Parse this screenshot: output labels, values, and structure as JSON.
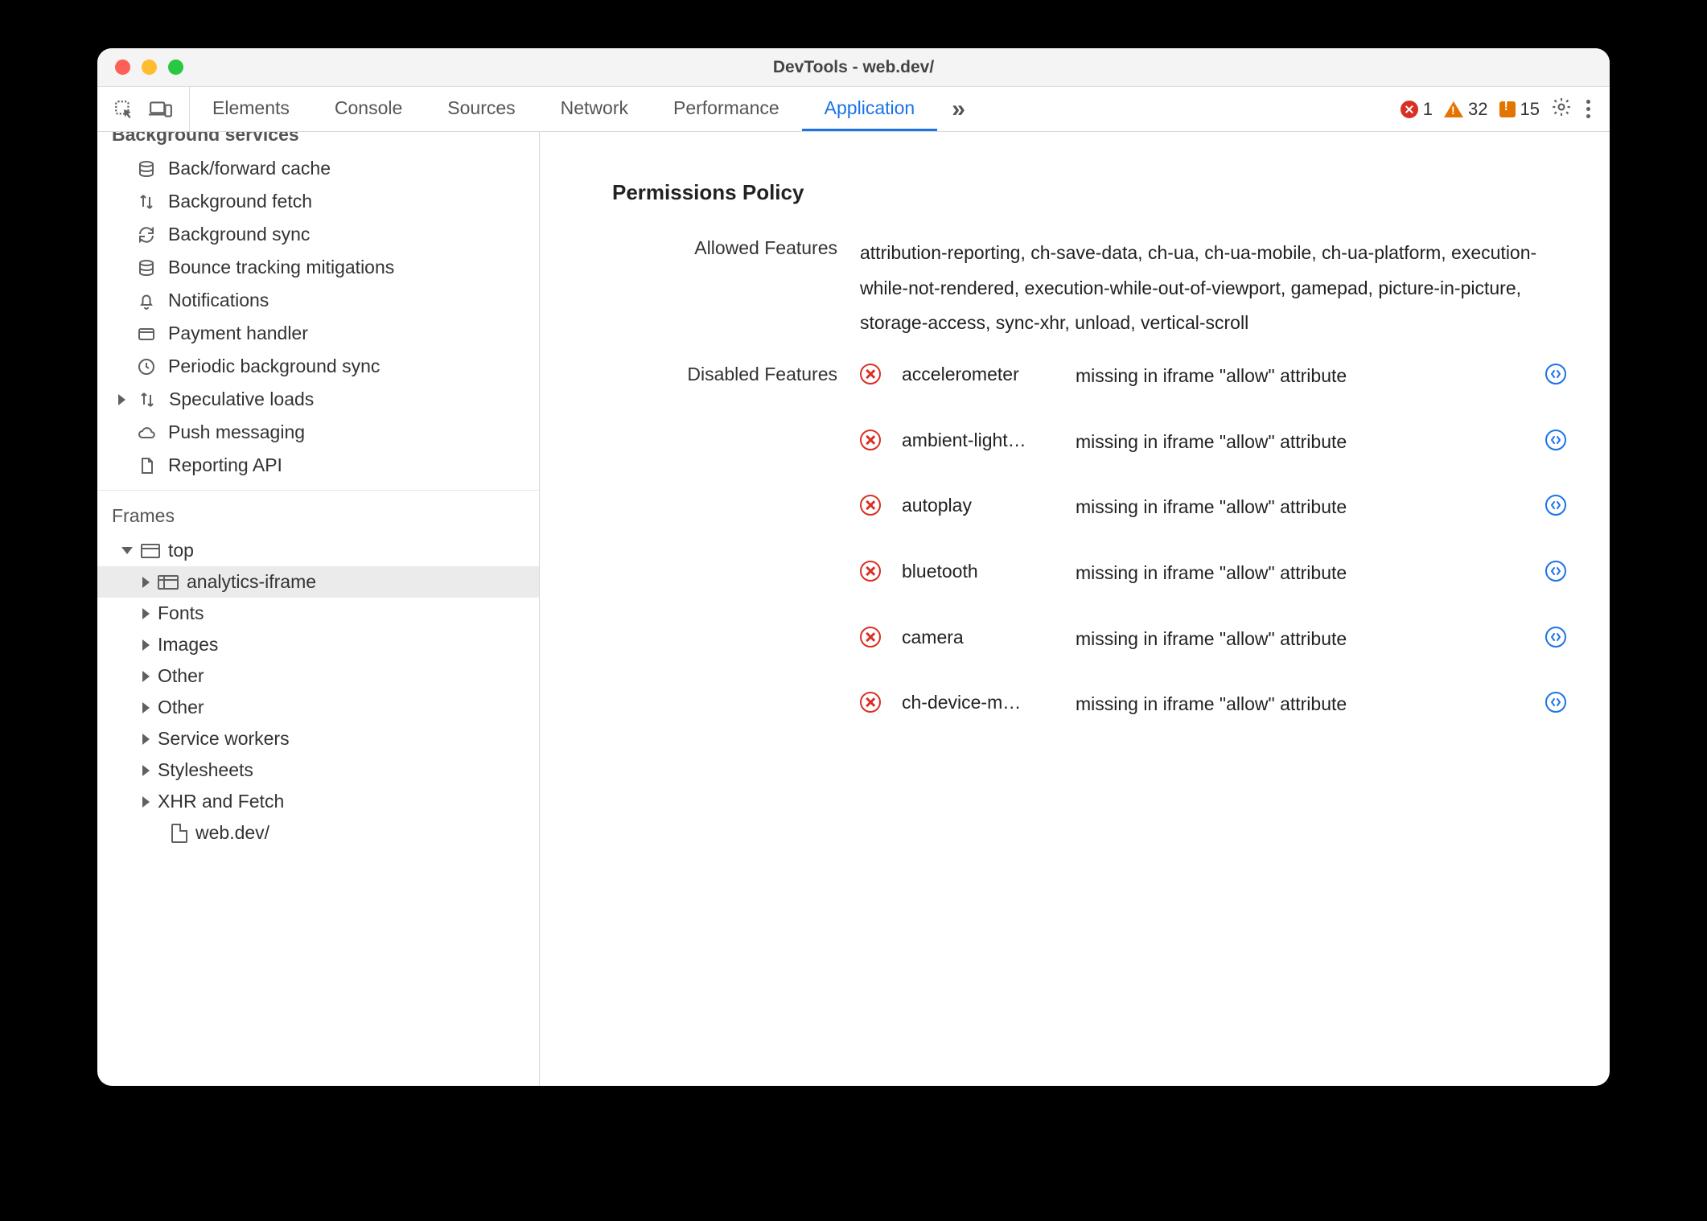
{
  "window": {
    "title": "DevTools - web.dev/"
  },
  "toolbar": {
    "tabs": [
      "Elements",
      "Console",
      "Sources",
      "Network",
      "Performance",
      "Application"
    ],
    "active_tab_index": 5,
    "issues": {
      "errors": "1",
      "warnings": "32",
      "other": "15"
    }
  },
  "sidebar": {
    "section_heading_cut": "Background services",
    "bg_services": [
      {
        "icon": "db",
        "label": "Back/forward cache"
      },
      {
        "icon": "arrows",
        "label": "Background fetch"
      },
      {
        "icon": "sync",
        "label": "Background sync"
      },
      {
        "icon": "db",
        "label": "Bounce tracking mitigations"
      },
      {
        "icon": "bell",
        "label": "Notifications"
      },
      {
        "icon": "card",
        "label": "Payment handler"
      },
      {
        "icon": "clock",
        "label": "Periodic background sync"
      },
      {
        "icon": "arrows",
        "label": "Speculative loads",
        "expandable": true
      },
      {
        "icon": "cloud",
        "label": "Push messaging"
      },
      {
        "icon": "doc",
        "label": "Reporting API"
      }
    ],
    "frames_title": "Frames",
    "frames_tree": {
      "top_label": "top",
      "selected_child": "analytics-iframe",
      "children": [
        "Fonts",
        "Images",
        "Other",
        "Other",
        "Service workers",
        "Stylesheets",
        "XHR and Fetch"
      ],
      "leaf_doc": "web.dev/"
    }
  },
  "content": {
    "title": "Permissions Policy",
    "allowed_label": "Allowed Features",
    "allowed_value": "attribution-reporting, ch-save-data, ch-ua, ch-ua-mobile, ch-ua-platform, execution-while-not-rendered, execution-while-out-of-viewport, gamepad, picture-in-picture, storage-access, sync-xhr, unload, vertical-scroll",
    "disabled_label": "Disabled Features",
    "disabled_reason": "missing in iframe \"allow\" attribute",
    "disabled": [
      {
        "feature": "accelerometer"
      },
      {
        "feature": "ambient-light…"
      },
      {
        "feature": "autoplay"
      },
      {
        "feature": "bluetooth"
      },
      {
        "feature": "camera"
      },
      {
        "feature": "ch-device-m…"
      }
    ]
  }
}
